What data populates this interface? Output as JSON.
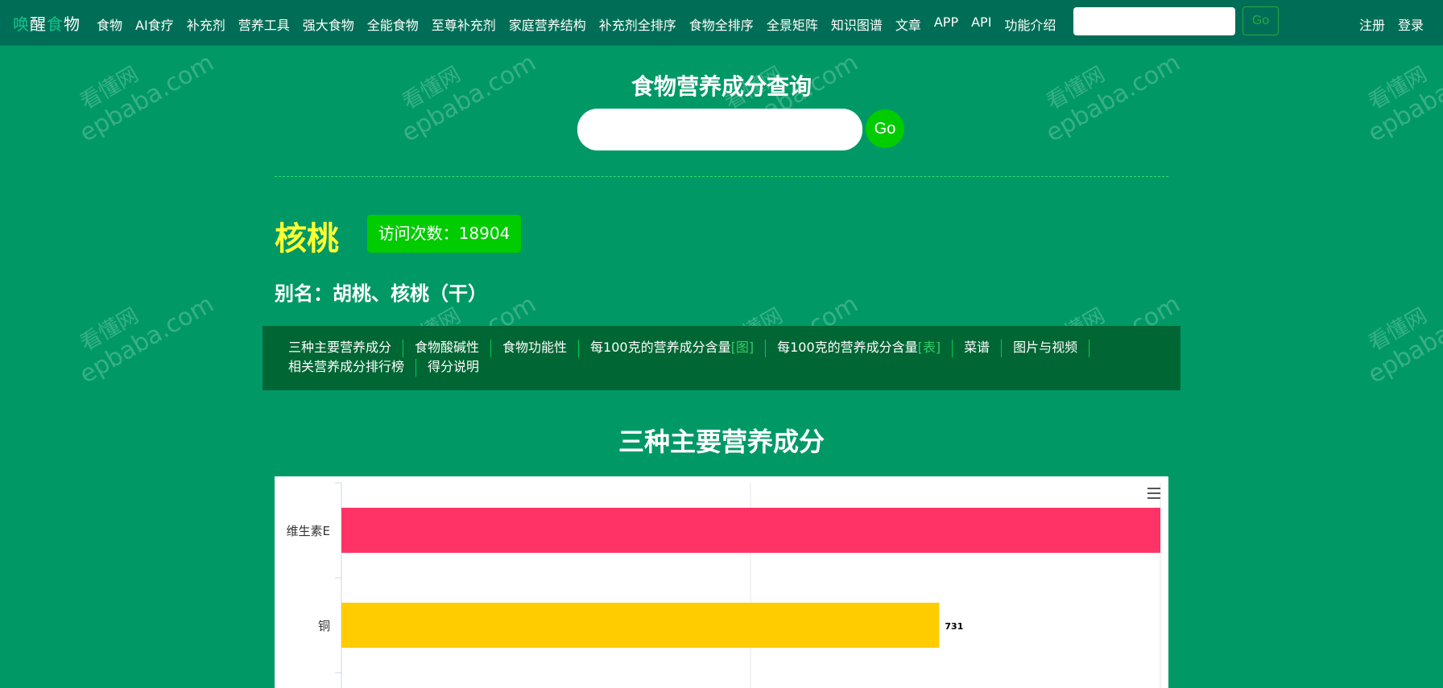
{
  "brand": {
    "part1": "唤",
    "part2": "醒",
    "part3": "食",
    "part4": "物"
  },
  "nav": {
    "items": [
      "食物",
      "AI食疗",
      "补充剂",
      "营养工具",
      "强大食物",
      "全能食物",
      "至尊补充剂",
      "家庭营养结构",
      "补充剂全排序",
      "食物全排序",
      "全景矩阵",
      "知识图谱",
      "文章",
      "APP",
      "API",
      "功能介绍"
    ],
    "search_placeholder": "",
    "go_label": "Go",
    "register": "注册",
    "login": "登录"
  },
  "watermark": {
    "line1": "看懂网",
    "line2": "epbaba.com"
  },
  "search": {
    "title": "食物营养成分查询",
    "placeholder": "",
    "go_label": "Go"
  },
  "food": {
    "name": "核桃",
    "visits_label": "访问次数：18904",
    "alias": "别名：胡桃、核桃（干）"
  },
  "subnav": {
    "row1": [
      {
        "text": "三种主要营养成分",
        "tag": ""
      },
      {
        "text": "食物酸碱性",
        "tag": ""
      },
      {
        "text": "食物功能性",
        "tag": ""
      },
      {
        "text": "每100克的营养成分含量",
        "tag": "[图]"
      },
      {
        "text": "每100克的营养成分含量",
        "tag": "[表]"
      },
      {
        "text": "菜谱",
        "tag": ""
      },
      {
        "text": "图片与视频",
        "tag": ""
      }
    ],
    "row2": [
      {
        "text": "相关营养成分排行榜",
        "tag": ""
      },
      {
        "text": "得分说明",
        "tag": ""
      }
    ]
  },
  "section": {
    "title": "三种主要营养成分"
  },
  "colors": {
    "vitamin_e": "#ff3366",
    "copper": "#ffcc00",
    "bg": "#009966",
    "nav": "#006e56"
  },
  "chart_data": {
    "type": "bar",
    "orientation": "horizontal",
    "categories": [
      "维生素E",
      "铜"
    ],
    "values": [
      null,
      731
    ],
    "data_labels": [
      "",
      "731"
    ],
    "colors": [
      "#ff3366",
      "#ffcc00"
    ],
    "grid": true
  }
}
